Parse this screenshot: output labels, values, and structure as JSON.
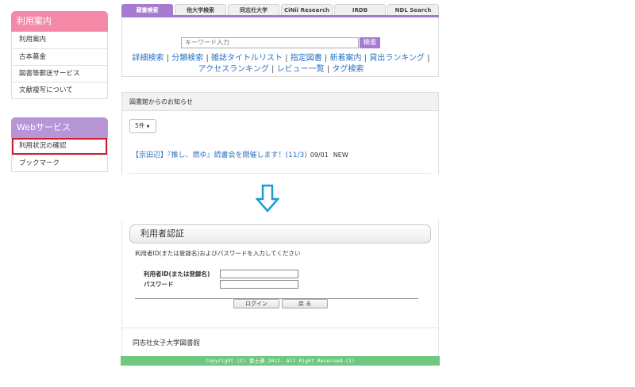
{
  "sidebar": {
    "guide": {
      "title": "利用案内",
      "items": [
        "利用案内",
        "古本募金",
        "図書等郵送サービス",
        "文献複写について"
      ]
    },
    "web": {
      "title": "Webサービス",
      "items": [
        "利用状況の確認",
        "ブックマーク"
      ]
    }
  },
  "search": {
    "tabs": [
      "蔵書検索",
      "他大学検索",
      "同志社大学",
      "CiNii Research",
      "IRDB",
      "NDL Search"
    ],
    "placeholder": "キーワード入力",
    "button": "検索",
    "links": [
      "詳細検索",
      "分類検索",
      "雑誌タイトルリスト",
      "指定図書",
      "新着案内",
      "貸出ランキング",
      "アクセスランキング",
      "レビュー一覧",
      "タグ検索"
    ]
  },
  "news": {
    "header": "図書館からのお知らせ",
    "count_select": "5件",
    "item": {
      "title": "【京田辺】『推し、燃ゆ』読書会を開催します！(11/3)",
      "date": "09/01",
      "badge": "NEW"
    }
  },
  "login": {
    "heading": "利用者認証",
    "instruction": "利用者ID(または登録名)およびパスワードを入力してください",
    "id_label": "利用者ID(または登録名)",
    "password_label": "パスワード",
    "login_button": "ログイン",
    "back_button": "戻 る",
    "library_name": "同志社女子大学図書館",
    "copyright": "Copyright (C) 富士通 2012- All Right Reserved.(1)"
  },
  "colors": {
    "pink_header": "#f58aa8",
    "purple_header": "#b696d6",
    "tab_accent": "#a57bd0",
    "link_blue": "#2a72c2",
    "highlight_red": "#cc1f2e",
    "arrow_blue": "#1a9ad6",
    "footer_green": "#6ec87f"
  },
  "icons": {
    "arrow": "down-arrow-icon",
    "caret": "caret-down-icon"
  }
}
